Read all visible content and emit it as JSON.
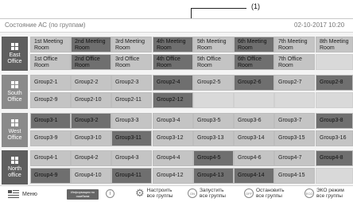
{
  "callout": {
    "label": "(1)"
  },
  "header": {
    "title": "Состояние АС (по группам)",
    "datetime": "02-10-2017 10:20"
  },
  "offices": [
    {
      "label_line1": "East",
      "label_line2": "Office",
      "label_color": "#5f5f5f",
      "rows": [
        [
          {
            "t": "1st Meeting Room",
            "s": "light"
          },
          {
            "t": "2nd Meeting Room",
            "s": "dark"
          },
          {
            "t": "3rd Meeting Room",
            "s": "light"
          },
          {
            "t": "4th Meeting Room",
            "s": "dark"
          },
          {
            "t": "5th Meeting Room",
            "s": "light"
          },
          {
            "t": "6th Meeting Room",
            "s": "dark"
          },
          {
            "t": "7th Meeting Room",
            "s": "light"
          },
          {
            "t": "8th Meeting Room",
            "s": "light"
          }
        ],
        [
          {
            "t": "1st Office Room",
            "s": "light"
          },
          {
            "t": "2nd Office Room",
            "s": "dark"
          },
          {
            "t": "3rd Office Room",
            "s": "light"
          },
          {
            "t": "4th Office Room",
            "s": "dark"
          },
          {
            "t": "5th Office Room",
            "s": "light"
          },
          {
            "t": "6th Office Room",
            "s": "dark"
          },
          {
            "t": "7th Office Room",
            "s": "light"
          },
          {
            "t": "",
            "s": "empty"
          }
        ]
      ]
    },
    {
      "label_line1": "South",
      "label_line2": "Office",
      "label_color": "#8a8a8a",
      "rows": [
        [
          {
            "t": "Group2-1",
            "s": "light"
          },
          {
            "t": "Group2-2",
            "s": "light"
          },
          {
            "t": "Group2-3",
            "s": "light"
          },
          {
            "t": "Group2-4",
            "s": "dark"
          },
          {
            "t": "Group2-5",
            "s": "light"
          },
          {
            "t": "Group2-6",
            "s": "dark"
          },
          {
            "t": "Group2-7",
            "s": "light"
          },
          {
            "t": "Group2-8",
            "s": "dark"
          }
        ],
        [
          {
            "t": "Group2-9",
            "s": "light"
          },
          {
            "t": "Group2-10",
            "s": "light"
          },
          {
            "t": "Group2-11",
            "s": "light"
          },
          {
            "t": "Group2-12",
            "s": "dark"
          },
          {
            "t": "",
            "s": "empty"
          },
          {
            "t": "",
            "s": "empty"
          },
          {
            "t": "",
            "s": "empty"
          },
          {
            "t": "",
            "s": "empty"
          }
        ]
      ]
    },
    {
      "label_line1": "West",
      "label_line2": "Office",
      "label_color": "#8a8a8a",
      "rows": [
        [
          {
            "t": "Group3-1",
            "s": "dark"
          },
          {
            "t": "Group3-2",
            "s": "dark"
          },
          {
            "t": "Group3-3",
            "s": "light"
          },
          {
            "t": "Group3-4",
            "s": "light"
          },
          {
            "t": "Group3-5",
            "s": "light"
          },
          {
            "t": "Group3-6",
            "s": "light"
          },
          {
            "t": "Group3-7",
            "s": "light"
          },
          {
            "t": "Group3-8",
            "s": "dark"
          }
        ],
        [
          {
            "t": "Group3-9",
            "s": "light"
          },
          {
            "t": "Group3-10",
            "s": "light"
          },
          {
            "t": "Group3-11",
            "s": "dark"
          },
          {
            "t": "Group3-12",
            "s": "light"
          },
          {
            "t": "Group3-13",
            "s": "light"
          },
          {
            "t": "Group3-14",
            "s": "light"
          },
          {
            "t": "Group3-15",
            "s": "light"
          },
          {
            "t": "Group3-16",
            "s": "light"
          }
        ]
      ]
    },
    {
      "label_line1": "North",
      "label_line2": "office",
      "label_color": "#5f5f5f",
      "rows": [
        [
          {
            "t": "Group4-1",
            "s": "light"
          },
          {
            "t": "Group4-2",
            "s": "light"
          },
          {
            "t": "Group4-3",
            "s": "light"
          },
          {
            "t": "Group4-4",
            "s": "light"
          },
          {
            "t": "Group4-5",
            "s": "dark"
          },
          {
            "t": "Group4-6",
            "s": "light"
          },
          {
            "t": "Group4-7",
            "s": "light"
          },
          {
            "t": "Group4-8",
            "s": "dark"
          }
        ],
        [
          {
            "t": "Group4-9",
            "s": "dark"
          },
          {
            "t": "Group4-10",
            "s": "light"
          },
          {
            "t": "Group4-11",
            "s": "dark"
          },
          {
            "t": "Group4-12",
            "s": "light"
          },
          {
            "t": "Group4-13",
            "s": "dark"
          },
          {
            "t": "Group4-14",
            "s": "dark"
          },
          {
            "t": "Group4-15",
            "s": "light"
          },
          {
            "t": "",
            "s": "empty"
          }
        ]
      ]
    }
  ],
  "bottombar": {
    "menu_label": "Меню",
    "info_button": "Информация по ошибкам",
    "configure_all": "Настроить все группы",
    "start_all": "Запустить все группы",
    "stop_all": "Остановить все группы",
    "eco_all": "ЭКО режим все группы",
    "on_icon_text": "ON",
    "off_icon_text": "OFF",
    "eco_icon_text": "ECO"
  }
}
